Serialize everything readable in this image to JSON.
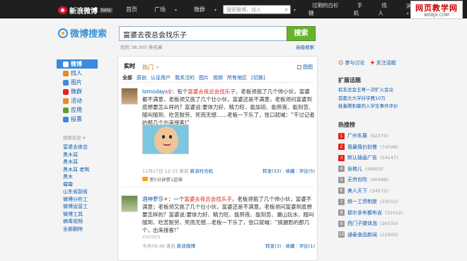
{
  "topbar": {
    "brand": "新浪微博",
    "beta": "beta",
    "nav": [
      "首页",
      "广场",
      "微群",
      "应用",
      "游戏"
    ],
    "nav_dropdown": [
      false,
      true,
      true,
      true,
      true
    ],
    "search_placeholder": "搜索微博，找人",
    "right_links": [
      "过期的白衫糖",
      "手机",
      "找人",
      "消息",
      "帐号"
    ],
    "right_dropdown": [
      false,
      false,
      false,
      true,
      true
    ]
  },
  "watermark": {
    "line1": "网页教学网",
    "line2": "WEBJX.COM"
  },
  "search": {
    "brand": "微博搜索",
    "query": "富婆去夜总会找乐子",
    "button": "搜索",
    "found": "找到 38,305 条结果",
    "advanced": "高级搜索"
  },
  "left_nav": [
    {
      "label": "微博",
      "active": true,
      "icon": "weibo-icon",
      "color": "#ffffff"
    },
    {
      "label": "找人",
      "active": false,
      "icon": "people-icon",
      "color": "#e98b1f"
    },
    {
      "label": "图片",
      "active": false,
      "icon": "image-icon",
      "color": "#3a8be0"
    },
    {
      "label": "微群",
      "active": false,
      "icon": "group-icon",
      "color": "#e2231a"
    },
    {
      "label": "活动",
      "active": false,
      "icon": "event-icon",
      "color": "#e98b1f"
    },
    {
      "label": "应用",
      "active": false,
      "icon": "app-icon",
      "color": "#5aa02c"
    },
    {
      "label": "投票",
      "active": false,
      "icon": "vote-icon",
      "color": "#3a8be0"
    }
  ],
  "history": {
    "title": "搜索历史 ▾",
    "items": [
      "富婆去夜总",
      "黑木耳",
      "黑木耳",
      "黑木耳 老鸭",
      "黑木",
      "霉霉",
      "山东省副省",
      "微博分析工",
      "微博运营工",
      "微博工具",
      "病毒视频",
      "全部删除"
    ]
  },
  "main": {
    "tabs": [
      {
        "label": "实时",
        "state": "sel"
      },
      {
        "label": "热门",
        "state": "hot"
      },
      {
        "label": "",
        "state": ""
      }
    ],
    "hot_mark": "▾",
    "images_check": "图图",
    "filters": [
      "全部",
      "原创",
      "认证用户",
      "我关注的",
      "图片",
      "视频",
      "所有地区",
      "[切换]"
    ],
    "filter_on": 0
  },
  "posts": [
    {
      "name": "lomodays",
      "badge": "♀",
      "pre": "：有个",
      "kw": "富婆去夜总会找乐子",
      "text": "，老板领挑了几个帅小伙，富婆都不满意，老板领又挑了几个壮小伙，富婆还是不满意，老板领问富婆到底想要怎么样的？富婆说:要体力好、精力旺、能加班、能熬夜、能刻苦、随叫随到、吃苦耐劳、死而无憾……老板一下乐了，张口就喊：“干过记者的那几个出来接客!”",
      "time": "11月17日 12:15",
      "source_pre": "来自",
      "source": "新浪时光机",
      "actions": [
        "转发(33)",
        "收藏",
        "评论(5)"
      ],
      "tag": "第5分钟第1超章"
    },
    {
      "name": "酒神萝莎",
      "badge": "♦",
      "pre": "：一个",
      "kw": "富婆去夜总会找乐子",
      "text": "，老板领挑了几个帅小伙，富婆不满意；老板领又挑了几个壮小伙，富婆还是不满意。老板领问富婆到底想要怎样的？富婆说:要体力好、精力旺、能熬夜、能刻苦、漏山玩水、随叫随到、吃苦耐劳、死而无憾…老板一下乐了，张口就喊：“搞摄影的那几个，出来接客!”",
      "time": "今天09:49",
      "source_pre": "来自",
      "source": "新浪微博",
      "actions": [
        "转发(3)",
        "收藏",
        "评论(1)"
      ],
      "tag": ""
    }
  ],
  "right": {
    "top_links": [
      "参与讨论",
      "关注话题"
    ],
    "ext_title": "扩展话题",
    "ext_links": [
      "棕玄总会五萼一次旷火会议",
      "首都大大学抖学费10万",
      "抵着腾刺豪的入学生事件评价"
    ],
    "hot_title": "热搜榜",
    "hot": [
      {
        "rank": "1",
        "label": "广州车展",
        "count": "(92370)"
      },
      {
        "rank": "2",
        "label": "我最佩价封曼",
        "count": "(74598)"
      },
      {
        "rank": "3",
        "label": "默认插画广告",
        "count": "(54147)"
      },
      {
        "rank": "4",
        "label": "张艳儿",
        "count": "(49803)"
      },
      {
        "rank": "5",
        "label": "无穷也吹",
        "count": "(40488)"
      },
      {
        "rank": "6",
        "label": "美人天下",
        "count": "(34575)"
      },
      {
        "rank": "7",
        "label": "统一工资制度",
        "count": "(33502)"
      },
      {
        "rank": "8",
        "label": "耶尔多布都布吉",
        "count": "(32502)"
      },
      {
        "rank": "9",
        "label": "西门子媒体泡",
        "count": "(26550)"
      },
      {
        "rank": "10",
        "label": "通泰食品新闻",
        "count": "(22900)"
      }
    ]
  }
}
